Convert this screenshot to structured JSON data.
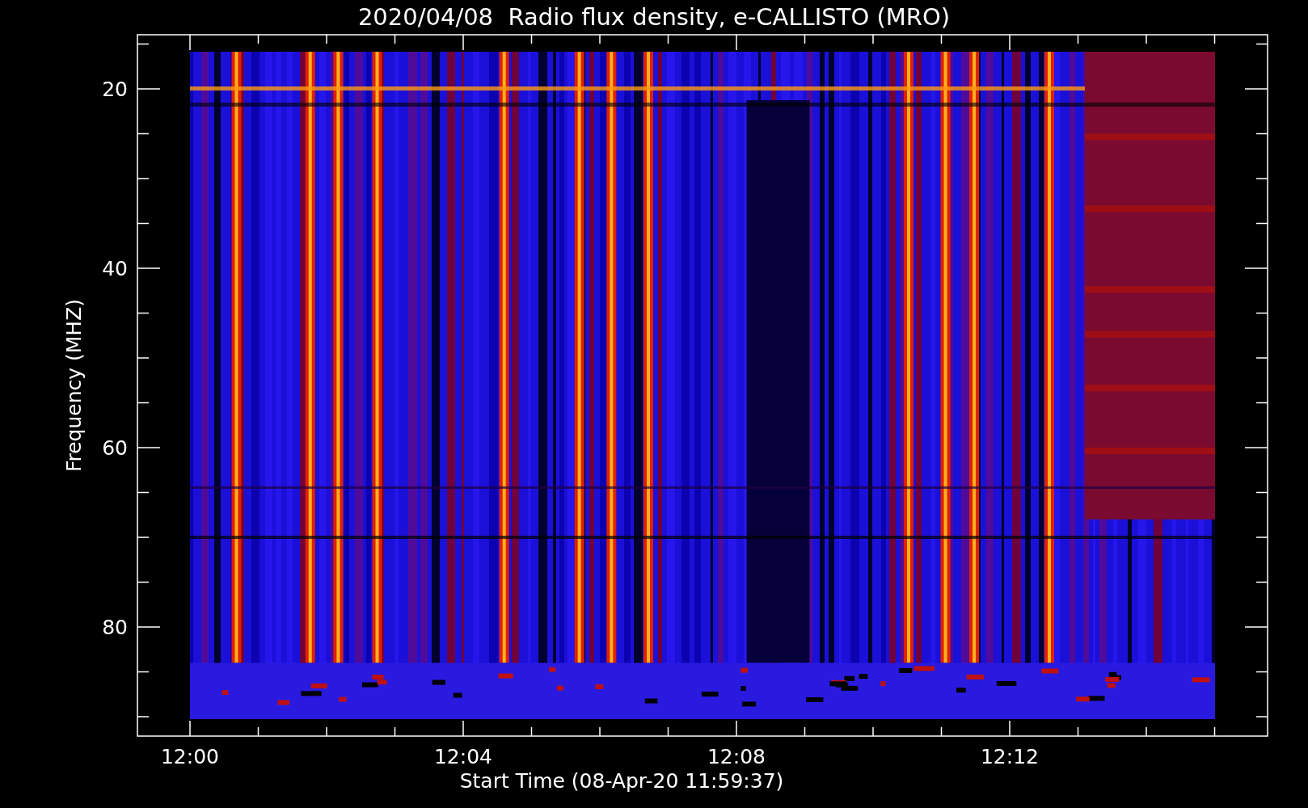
{
  "chart": {
    "title": "2020/04/08  Radio flux density, e-CALLISTO (MRO)",
    "xlabel": "Start Time (08-Apr-20 11:59:37)",
    "ylabel": "Frequency (MHZ)",
    "xticks": [
      "12:00",
      "12:04",
      "12:08",
      "12:12"
    ],
    "yticks": [
      "20",
      "40",
      "60",
      "80"
    ]
  }
}
